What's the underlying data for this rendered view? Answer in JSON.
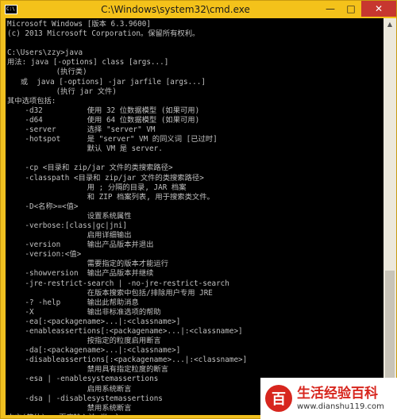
{
  "window": {
    "title": "C:\\Windows\\system32\\cmd.exe",
    "icon_label": "C:\\",
    "minimize_glyph": "—",
    "maximize_glyph": "□",
    "close_glyph": "✕"
  },
  "console": {
    "lines": [
      "Microsoft Windows [版本 6.3.9600]",
      "(c) 2013 Microsoft Corporation。保留所有权利。",
      "",
      "C:\\Users\\zzy>java",
      "用法: java [-options] class [args...]",
      "           (执行类)",
      "   或  java [-options] -jar jarfile [args...]",
      "           (执行 jar 文件)",
      "其中选项包括:",
      "    -d32          使用 32 位数据模型 (如果可用)",
      "    -d64          使用 64 位数据模型 (如果可用)",
      "    -server       选择 \"server\" VM",
      "    -hotspot      是 \"server\" VM 的同义词 [已过时]",
      "                  默认 VM 是 server.",
      "",
      "    -cp <目录和 zip/jar 文件的类搜索路径>",
      "    -classpath <目录和 zip/jar 文件的类搜索路径>",
      "                  用 ; 分隔的目录, JAR 档案",
      "                  和 ZIP 档案列表, 用于搜索类文件。",
      "    -D<名称>=<值>",
      "                  设置系统属性",
      "    -verbose:[class|gc|jni]",
      "                  启用详细输出",
      "    -version      输出产品版本并退出",
      "    -version:<值>",
      "                  需要指定的版本才能运行",
      "    -showversion  输出产品版本并继续",
      "    -jre-restrict-search | -no-jre-restrict-search",
      "                  在版本搜索中包括/排除用户专用 JRE",
      "    -? -help      输出此帮助消息",
      "    -X            输出非标准选项的帮助",
      "    -ea[:<packagename>...|:<classname>]",
      "    -enableassertions[:<packagename>...|:<classname>]",
      "                  按指定的粒度启用断言",
      "    -da[:<packagename>...|:<classname>]",
      "    -disableassertions[:<packagename>...|:<classname>]",
      "                  禁用具有指定粒度的断言",
      "    -esa | -enablesystemassertions",
      "                  启用系统断言",
      "    -dsa | -disablesystemassertions",
      "                  禁用系统断言",
      "中文(简体) - 百度输入法 半 ：）"
    ]
  },
  "scrollbar": {
    "up_glyph": "▲",
    "down_glyph": "▼"
  },
  "watermark": {
    "logo_char": "百",
    "name": "生活经验百科",
    "url": "www.dianshu119.com"
  }
}
